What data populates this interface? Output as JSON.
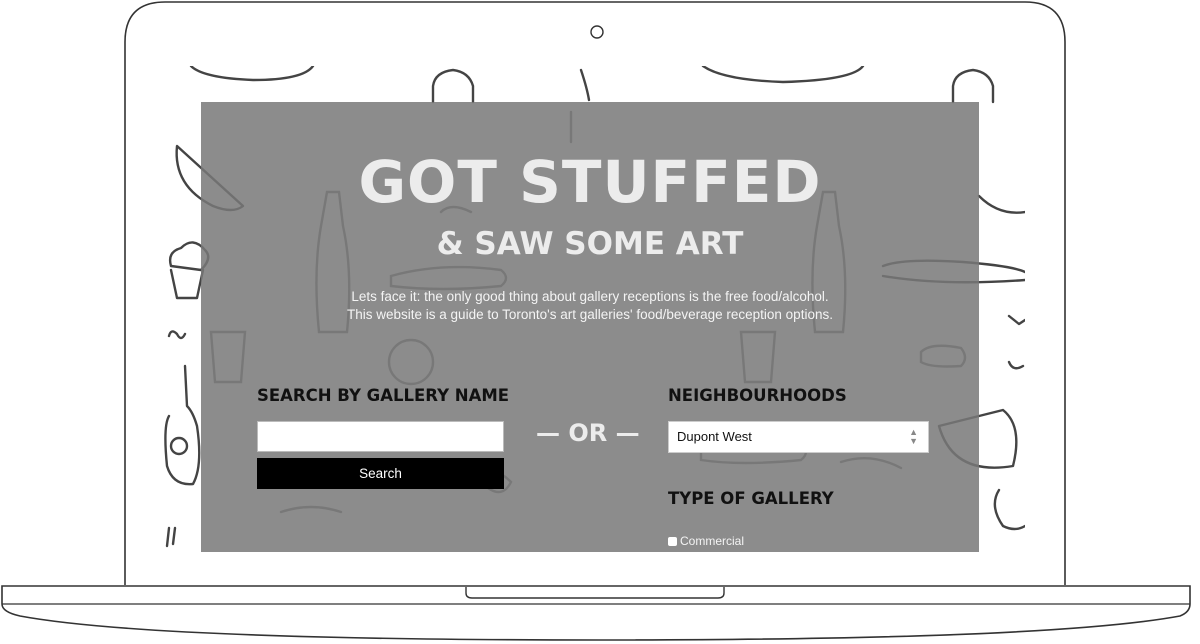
{
  "hero": {
    "title": "GOT STUFFED",
    "subtitle": "& SAW SOME ART",
    "intro": "Lets face it: the only good thing about gallery receptions is the free food/alcohol. This website is a guide to Toronto's art galleries' food/beverage reception options."
  },
  "search": {
    "heading": "SEARCH BY GALLERY NAME",
    "input_value": "",
    "button_label": "Search"
  },
  "divider": "— OR —",
  "neighbourhoods": {
    "heading": "NEIGHBOURHOODS",
    "selected": "Dupont West"
  },
  "gallery_type": {
    "heading": "TYPE OF GALLERY",
    "options": [
      {
        "label": "Commercial",
        "checked": false
      }
    ]
  },
  "icons": {
    "camera": "camera-dot-icon",
    "select_arrows": "updown-chevron-icon",
    "background": "food-doodle-pattern"
  },
  "colors": {
    "hero_overlay": "#7a7a7a",
    "title_text": "#ececec",
    "heading_text": "#111111",
    "button_bg": "#000000"
  }
}
